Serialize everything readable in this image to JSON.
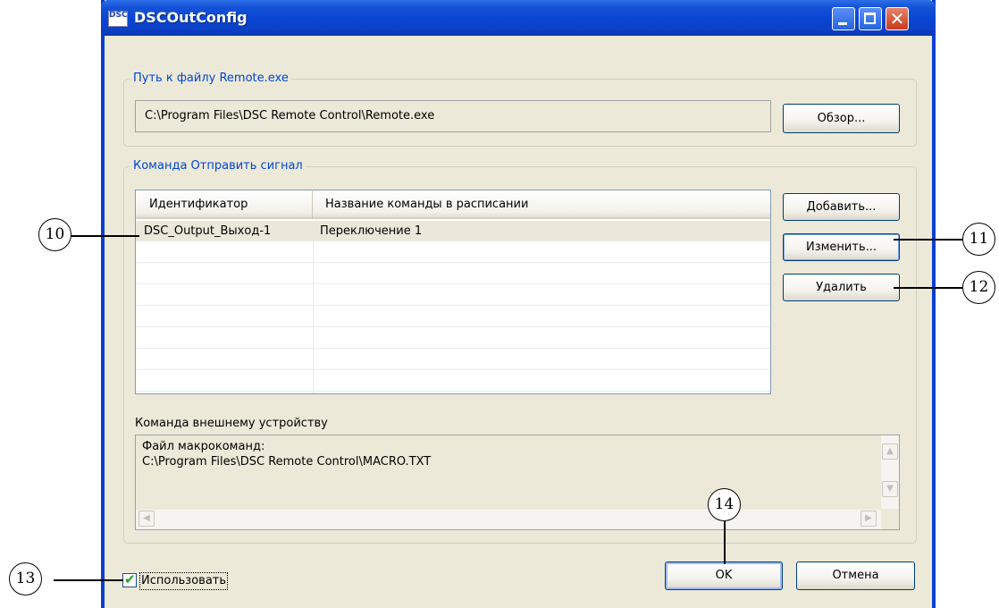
{
  "window": {
    "title": "DSCOutConfig",
    "icon_text": "DSC",
    "close_glyph": "✕"
  },
  "path_group": {
    "label": "Путь к файлу Remote.exe",
    "path_value": "C:\\Program Files\\DSC Remote Control\\Remote.exe",
    "browse_label": "Обзор..."
  },
  "command_group": {
    "label": "Команда Отправить сигнал",
    "columns": [
      "Идентификатор",
      "Название команды в расписании"
    ],
    "rows": [
      {
        "id": "DSC_Output_Выход-1",
        "name": "Переключение 1"
      }
    ],
    "add_label": "Добавить...",
    "edit_label": "Изменить...",
    "delete_label": "Удалить",
    "device_label": "Команда внешнему устройству",
    "device_line1": "Файл макрокоманд:",
    "device_line2": "C:\\Program Files\\DSC Remote Control\\MACRO.TXT"
  },
  "footer": {
    "use_label": "Использовать",
    "ok_label": "OK",
    "cancel_label": "Отмена"
  },
  "callouts": {
    "c10": "10",
    "c11": "11",
    "c12": "12",
    "c13": "13",
    "c14": "14"
  },
  "colors": {
    "titlebar": "#0a45d2",
    "group_label": "#0046d5",
    "dialog_bg": "#ece9d8",
    "checkbox_tick": "#21a121"
  }
}
